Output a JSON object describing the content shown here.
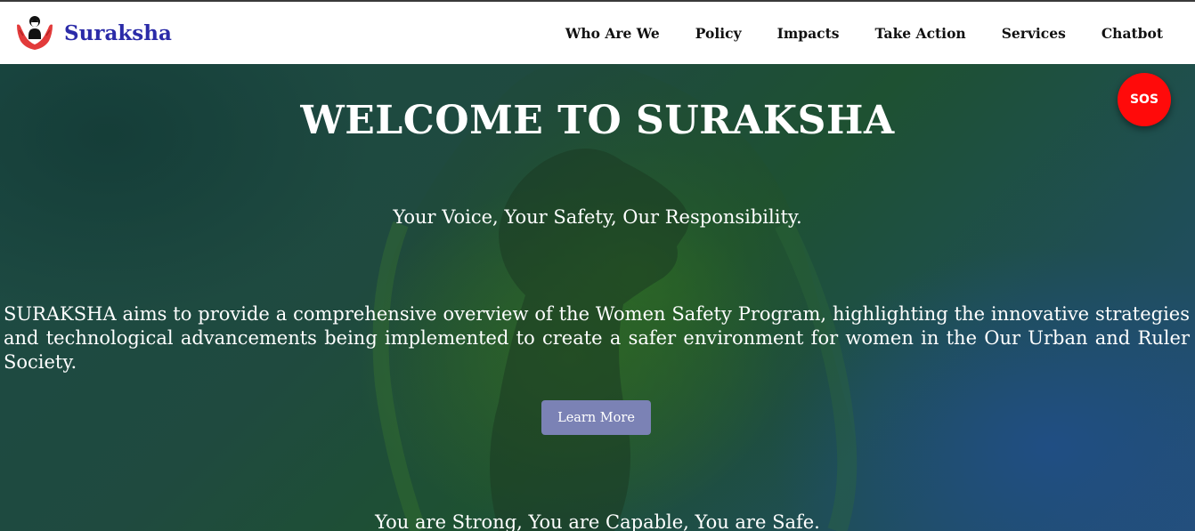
{
  "header": {
    "brand_name": "Suraksha",
    "logo_icon": "woman-in-hands-icon",
    "nav": [
      {
        "label": "Who Are We"
      },
      {
        "label": "Policy"
      },
      {
        "label": "Impacts"
      },
      {
        "label": "Take Action"
      },
      {
        "label": "Services"
      },
      {
        "label": "Chatbot"
      }
    ]
  },
  "hero": {
    "title": "WELCOME TO SURAKSHA",
    "subtitle": "Your Voice, Your Safety, Our Responsibility.",
    "description": "SURAKSHA aims to provide a comprehensive overview of the Women Safety Program, highlighting the innovative strategies and technological advancements being implemented to create a safer environment for women in the Our Urban and Ruler Society.",
    "button_label": "Learn More",
    "tagline": "You are Strong, You are Capable, You are Safe.",
    "sos_label": "SOS"
  },
  "colors": {
    "brand": "#2b2ba8",
    "sos": "#ff0a0a",
    "button": "#7b82b5",
    "navbar_bg": "#ffffff"
  }
}
